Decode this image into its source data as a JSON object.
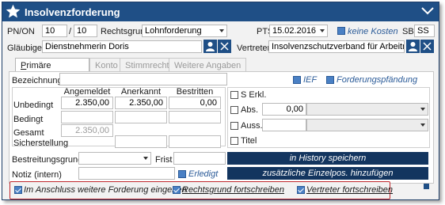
{
  "window": {
    "title": "Insolvenzforderung"
  },
  "header": {
    "pn_on_label": "PN/ON",
    "pn_value": "10",
    "on_separator": "/",
    "on_value": "10",
    "rechtsgrund_label": "Rechtsgrund",
    "rechtsgrund_value": "Lohnforderung",
    "pts_label": "PTS",
    "pts_value": "15.02.2016",
    "keine_kosten_label": "keine Kosten",
    "sb_label": "SB",
    "sb_value": "SS",
    "glaeubiger_label": "Gläubiger",
    "glaeubiger_value": "Dienstnehmerin Doris",
    "vertreter_label": "Vertreter",
    "vertreter_value": "Insolvenzschutzverband für Arbeitnehm"
  },
  "tabs": [
    {
      "label": "Primäre Angaben",
      "underline": "P",
      "rest": "rimäre Angaben"
    },
    {
      "label": "Konto"
    },
    {
      "label": "Stimmrecht"
    },
    {
      "label": "Weitere Angaben"
    }
  ],
  "form": {
    "bezeichnung_label": "Bezeichnung",
    "bezeichnung_value": "",
    "ief_label": "IEF",
    "forderungspfaendung_label": "Forderungspfändung",
    "columns": [
      "Angemeldet",
      "Anerkannt",
      "Bestritten"
    ],
    "rows": [
      {
        "label": "Unbedingt",
        "values": [
          "2.350,00",
          "2.350,00",
          "0,00"
        ]
      },
      {
        "label": "Bedingt",
        "values": [
          "",
          "",
          ""
        ]
      },
      {
        "label": "Gesamt",
        "values": [
          "2.350,00",
          "",
          ""
        ]
      },
      {
        "label": "Sicherstellung",
        "values": [
          "",
          "",
          ""
        ]
      }
    ],
    "s_erkl_label": "S Erkl.",
    "abs_label": "Abs.",
    "abs_value": "0,00",
    "auss_label": "Auss.",
    "titel_label": "Titel",
    "bestreitungsgrund_label": "Bestreitungsgrund",
    "frist_label": "Frist",
    "notiz_label": "Notiz (intern)",
    "erledigt_label": "Erledigt",
    "history_button": "in History speichern",
    "einzelpos_button": "zusätzliche Einzelpos. hinzufügen"
  },
  "footer": {
    "anschluss_label": "Im Anschluss weitere Forderung eingeben",
    "anschluss_underline": "A",
    "rechtsgrund_label": "Rechtsgrund fortschreiben",
    "vertreter_label": "Vertreter fortschreiben"
  },
  "colors": {
    "titlebar": "#1f4f86",
    "accent": "#2b5b98",
    "button": "#13355f",
    "highlight_border": "#c0282d"
  },
  "icons": [
    "star-icon",
    "chevron-down-icon",
    "person-icon",
    "close-icon",
    "dropdown-arrow-icon",
    "checkbox-checked-icon"
  ]
}
